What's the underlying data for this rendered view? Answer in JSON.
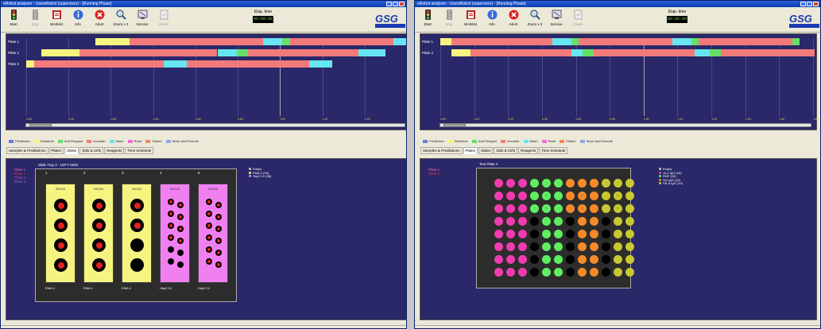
{
  "colors": {
    "predilution": "#6a78e0",
    "distribute": "#f6f480",
    "add_reagent": "#66e066",
    "incubate": "#f37a7a",
    "wash": "#66e6f0",
    "read": "#ef6ad8",
    "shaker": "#f28a5a",
    "move": "#9aa2f0"
  },
  "legend": [
    {
      "label": "Predilution",
      "color": "#6a78e0"
    },
    {
      "label": "Distribute",
      "color": "#f6f480"
    },
    {
      "label": "Add Reagent",
      "color": "#66e066"
    },
    {
      "label": "Incubate",
      "color": "#f37a7a"
    },
    {
      "label": "Wash",
      "color": "#66e6f0"
    },
    {
      "label": "Read",
      "color": "#ef6ad8"
    },
    {
      "label": "Shaker",
      "color": "#f28a5a"
    },
    {
      "label": "Move and Execute",
      "color": "#9aa2f0"
    }
  ],
  "toolbar": [
    {
      "label": "Start",
      "icon": "traffic-light-icon",
      "enabled": true
    },
    {
      "label": "Stop",
      "icon": "stop-light-icon",
      "enabled": false
    },
    {
      "label": "Worklist",
      "icon": "worklist-icon",
      "enabled": true
    },
    {
      "label": "Info",
      "icon": "info-icon",
      "enabled": true
    },
    {
      "label": "Abort",
      "icon": "abort-icon",
      "enabled": true
    },
    {
      "label": "Zoom x 2",
      "icon": "zoom-icon",
      "enabled": true
    },
    {
      "label": "Service",
      "icon": "service-icon",
      "enabled": true
    },
    {
      "label": "Check",
      "icon": "check-icon",
      "enabled": false
    }
  ],
  "tabs": [
    "Samples & Predilutions",
    "Plates",
    "Slides",
    "Stds & Ctrls",
    "Reagents",
    "Time Schedule"
  ],
  "windows": [
    {
      "title": "eRobot analyser - UsersRobot (supervisor) - [Running Phase]",
      "elapsed_label": "Elap. time",
      "elapsed_value": "00:00:00",
      "active_tab": 2,
      "plates": [
        "Plate 1",
        "Plate 2",
        "Plate 3",
        "Plate 4"
      ],
      "plate_colors": [
        "#f06ab0",
        "#f03030",
        "#c04aa0",
        "#8a6ab8"
      ],
      "gantt_rows": [
        {
          "label": "Plate 1",
          "segments": [
            {
              "s": 0.18,
              "e": 0.27,
              "c": "distribute"
            },
            {
              "s": 0.27,
              "e": 0.62,
              "c": "incubate"
            },
            {
              "s": 0.62,
              "e": 0.67,
              "c": "wash"
            },
            {
              "s": 0.67,
              "e": 0.69,
              "c": "add_reagent"
            },
            {
              "s": 0.69,
              "e": 0.96,
              "c": "incubate"
            },
            {
              "s": 0.96,
              "e": 1.0,
              "c": "wash"
            }
          ]
        },
        {
          "label": "Plate 2",
          "segments": [
            {
              "s": 0.04,
              "e": 0.14,
              "c": "distribute"
            },
            {
              "s": 0.14,
              "e": 0.5,
              "c": "incubate"
            },
            {
              "s": 0.5,
              "e": 0.55,
              "c": "wash"
            },
            {
              "s": 0.55,
              "e": 0.58,
              "c": "add_reagent"
            },
            {
              "s": 0.58,
              "e": 0.87,
              "c": "incubate"
            },
            {
              "s": 0.87,
              "e": 0.94,
              "c": "wash"
            }
          ]
        },
        {
          "label": "Plate 3",
          "segments": [
            {
              "s": 0.0,
              "e": 0.02,
              "c": "distribute"
            },
            {
              "s": 0.02,
              "e": 0.36,
              "c": "incubate"
            },
            {
              "s": 0.36,
              "e": 0.42,
              "c": "wash"
            },
            {
              "s": 0.42,
              "e": 0.74,
              "c": "incubate"
            },
            {
              "s": 0.74,
              "e": 0.8,
              "c": "wash"
            }
          ]
        }
      ],
      "ticks": [
        "0:00",
        "0:10",
        "0:20",
        "0:30",
        "0:40",
        "0:50",
        "1:00",
        "1:10",
        "1:20",
        "1:30"
      ],
      "tray_title": "Slide Tray 2 - LEFT SIDE",
      "slide_numbers": [
        "1",
        "2",
        "3",
        "4",
        "5"
      ],
      "slides": [
        {
          "name": "INOVA",
          "label": "EMA 4",
          "type": "big",
          "fill": "yellow",
          "wells": [
            1,
            1,
            1,
            1
          ]
        },
        {
          "name": "INOVA",
          "label": "EMA 4",
          "type": "big",
          "fill": "yellow",
          "wells": [
            1,
            1,
            1,
            1
          ]
        },
        {
          "name": "INOVA",
          "label": "EMA 4",
          "type": "big",
          "fill": "yellow",
          "wells": [
            1,
            1,
            0,
            0
          ]
        },
        {
          "name": "INOVA",
          "label": "Hep2 12",
          "type": "small",
          "fill": "pink",
          "wells": [
            1,
            1,
            1,
            1,
            1,
            1,
            1,
            1,
            0,
            0,
            0,
            0
          ]
        },
        {
          "name": "INOVA",
          "label": "Hep2 12",
          "type": "small",
          "fill": "pink",
          "wells": [
            1,
            1,
            1,
            1,
            1,
            1,
            1,
            1,
            1,
            1,
            1,
            1
          ]
        }
      ],
      "right_legend": [
        {
          "label": "Empty",
          "color": "#cccccc"
        },
        {
          "label": "EMA 4 (16)",
          "color": "#f6f480"
        },
        {
          "label": "Hep2 12 (28)",
          "color": "#f080f0"
        }
      ]
    },
    {
      "title": "eRobot analyser - UsersRobot (supervisor) - [Running Phase]",
      "elapsed_label": "Elap. time",
      "elapsed_value": "00:00:00",
      "active_tab": 1,
      "plates": [
        "Plate 1",
        "Plate 2"
      ],
      "plate_colors": [
        "#f06ab0",
        "#f03030"
      ],
      "gantt_rows": [
        {
          "label": "Plate 1",
          "segments": [
            {
              "s": 0.0,
              "e": 0.03,
              "c": "distribute"
            },
            {
              "s": 0.03,
              "e": 0.3,
              "c": "incubate"
            },
            {
              "s": 0.3,
              "e": 0.35,
              "c": "wash"
            },
            {
              "s": 0.35,
              "e": 0.37,
              "c": "add_reagent"
            },
            {
              "s": 0.37,
              "e": 0.62,
              "c": "incubate"
            },
            {
              "s": 0.62,
              "e": 0.67,
              "c": "wash"
            },
            {
              "s": 0.67,
              "e": 0.69,
              "c": "add_reagent"
            },
            {
              "s": 0.69,
              "e": 0.94,
              "c": "incubate"
            },
            {
              "s": 0.94,
              "e": 0.96,
              "c": "add_reagent"
            }
          ]
        },
        {
          "label": "Plate 2",
          "segments": [
            {
              "s": 0.03,
              "e": 0.08,
              "c": "distribute"
            },
            {
              "s": 0.08,
              "e": 0.35,
              "c": "incubate"
            },
            {
              "s": 0.35,
              "e": 0.38,
              "c": "wash"
            },
            {
              "s": 0.38,
              "e": 0.41,
              "c": "add_reagent"
            },
            {
              "s": 0.41,
              "e": 0.68,
              "c": "incubate"
            },
            {
              "s": 0.68,
              "e": 0.72,
              "c": "wash"
            },
            {
              "s": 0.72,
              "e": 0.75,
              "c": "add_reagent"
            },
            {
              "s": 0.75,
              "e": 1.0,
              "c": "incubate"
            }
          ]
        }
      ],
      "ticks": [
        "0:00",
        "0:10",
        "0:20",
        "0:30",
        "0:40",
        "0:50",
        "1:00",
        "1:10",
        "1:20",
        "1:30",
        "1:40",
        "1:50"
      ],
      "tray_title": "Test Plate 2",
      "plate_grid": {
        "columns": [
          {
            "color": "#f03cb0",
            "rows": [
              1,
              1,
              1,
              1,
              1,
              1,
              1,
              1
            ],
            "marks": [
              "",
              "",
              "",
              "",
              "",
              "",
              "",
              ""
            ]
          },
          {
            "color": "#f03cb0",
            "rows": [
              1,
              1,
              1,
              1,
              1,
              1,
              1,
              1
            ],
            "marks": [
              "",
              "",
              "",
              "",
              "",
              "",
              "",
              ""
            ]
          },
          {
            "color": "#f03cb0",
            "rows": [
              1,
              1,
              1,
              1,
              1,
              1,
              1,
              1
            ],
            "marks": [
              "",
              "",
              "",
              "",
              "",
              "",
              "",
              ""
            ]
          },
          {
            "color": "#60ee60",
            "rows": [
              1,
              1,
              1,
              0,
              0,
              0,
              0,
              0
            ],
            "marks": [
              "",
              "",
              "",
              "",
              "",
              "",
              "",
              ""
            ]
          },
          {
            "color": "#60ee60",
            "rows": [
              1,
              1,
              1,
              1,
              1,
              1,
              1,
              1
            ],
            "marks": [
              "",
              "C",
              "C",
              "",
              "",
              "",
              "",
              ""
            ]
          },
          {
            "color": "#60ee60",
            "rows": [
              1,
              1,
              1,
              1,
              1,
              1,
              1,
              1
            ],
            "marks": [
              "",
              "",
              "",
              "",
              "",
              "",
              "",
              ""
            ]
          },
          {
            "color": "#f58a2a",
            "rows": [
              1,
              1,
              1,
              0,
              0,
              0,
              0,
              0
            ],
            "marks": [
              "",
              "",
              "",
              "",
              "",
              "",
              "",
              ""
            ]
          },
          {
            "color": "#f58a2a",
            "rows": [
              1,
              1,
              1,
              1,
              1,
              1,
              1,
              1
            ],
            "marks": [
              "",
              "C",
              "C",
              "",
              "",
              "",
              "",
              ""
            ]
          },
          {
            "color": "#f58a2a",
            "rows": [
              1,
              1,
              1,
              1,
              1,
              1,
              1,
              1
            ],
            "marks": [
              "",
              "",
              "",
              "",
              "",
              "",
              "",
              ""
            ]
          },
          {
            "color": "#c8c830",
            "rows": [
              1,
              1,
              1,
              0,
              0,
              0,
              0,
              0
            ],
            "marks": [
              "",
              "",
              "",
              "",
              "",
              "",
              "",
              ""
            ]
          },
          {
            "color": "#c8c830",
            "rows": [
              1,
              1,
              1,
              1,
              1,
              1,
              1,
              1
            ],
            "marks": [
              "",
              "C",
              "C",
              "",
              "",
              "",
              "",
              ""
            ]
          },
          {
            "color": "#c8c830",
            "rows": [
              1,
              1,
              1,
              1,
              1,
              1,
              1,
              1
            ],
            "marks": [
              "",
              "",
              "",
              "",
              "",
              "",
              "",
              ""
            ]
          }
        ],
        "empty_color": "#000000"
      },
      "right_legend": [
        {
          "label": "Empty",
          "color": "#cccccc"
        },
        {
          "label": "Jo-1 IgG (19)",
          "color": "#f03cb0"
        },
        {
          "label": "RNP (19)",
          "color": "#60ee60"
        },
        {
          "label": "Sm IgG (19)",
          "color": "#f58a2a"
        },
        {
          "label": "SS-A IgG (19)",
          "color": "#c8c830"
        }
      ]
    }
  ]
}
